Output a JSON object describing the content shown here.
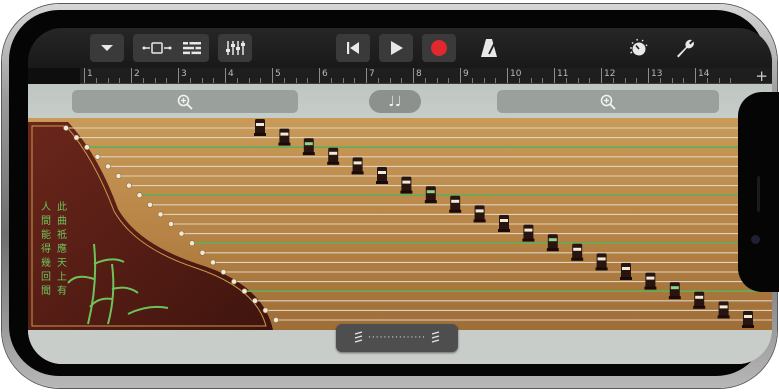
{
  "toolbar": {
    "buttons": [
      {
        "name": "browser-menu-button",
        "icon": "chevron-down-icon"
      },
      {
        "name": "tracks-view-button",
        "icon": "tracks-view-icon"
      },
      {
        "name": "mixer-list-button",
        "icon": "list-icon"
      },
      {
        "name": "eq-controls-button",
        "icon": "sliders-icon"
      },
      {
        "name": "go-to-beginning-button",
        "icon": "skip-back-icon"
      },
      {
        "name": "play-button",
        "icon": "play-icon"
      },
      {
        "name": "record-button",
        "icon": "record-icon"
      },
      {
        "name": "metronome-button",
        "icon": "metronome-icon"
      },
      {
        "name": "master-volume-button",
        "icon": "volume-knob-icon"
      },
      {
        "name": "settings-button",
        "icon": "wrench-icon"
      }
    ],
    "colors": {
      "record": "#e2282f",
      "button_bg": "#3a3a3a",
      "icon": "#e8e8e8"
    }
  },
  "ruler": {
    "bars": [
      "1",
      "2",
      "3",
      "4",
      "5",
      "6",
      "7",
      "8",
      "9",
      "10",
      "11",
      "12",
      "13",
      "14"
    ],
    "add_section_label": "+"
  },
  "instrument": {
    "name_hidden": true,
    "left_zoom_icon": "zoom-in-icon",
    "right_zoom_icon": "zoom-in-icon",
    "notes_toggle_label": "♩♩",
    "string_count": 21,
    "colors": {
      "wood": "#b98547",
      "string": "#d8d3c4",
      "green_string": "#5fae58",
      "body": "#5a1f16",
      "jade_lettering": "#6ec25a"
    },
    "poem_columns": [
      "此曲祗應天上有",
      "人間能得幾回聞"
    ],
    "scroll_handle_label": "···············"
  }
}
